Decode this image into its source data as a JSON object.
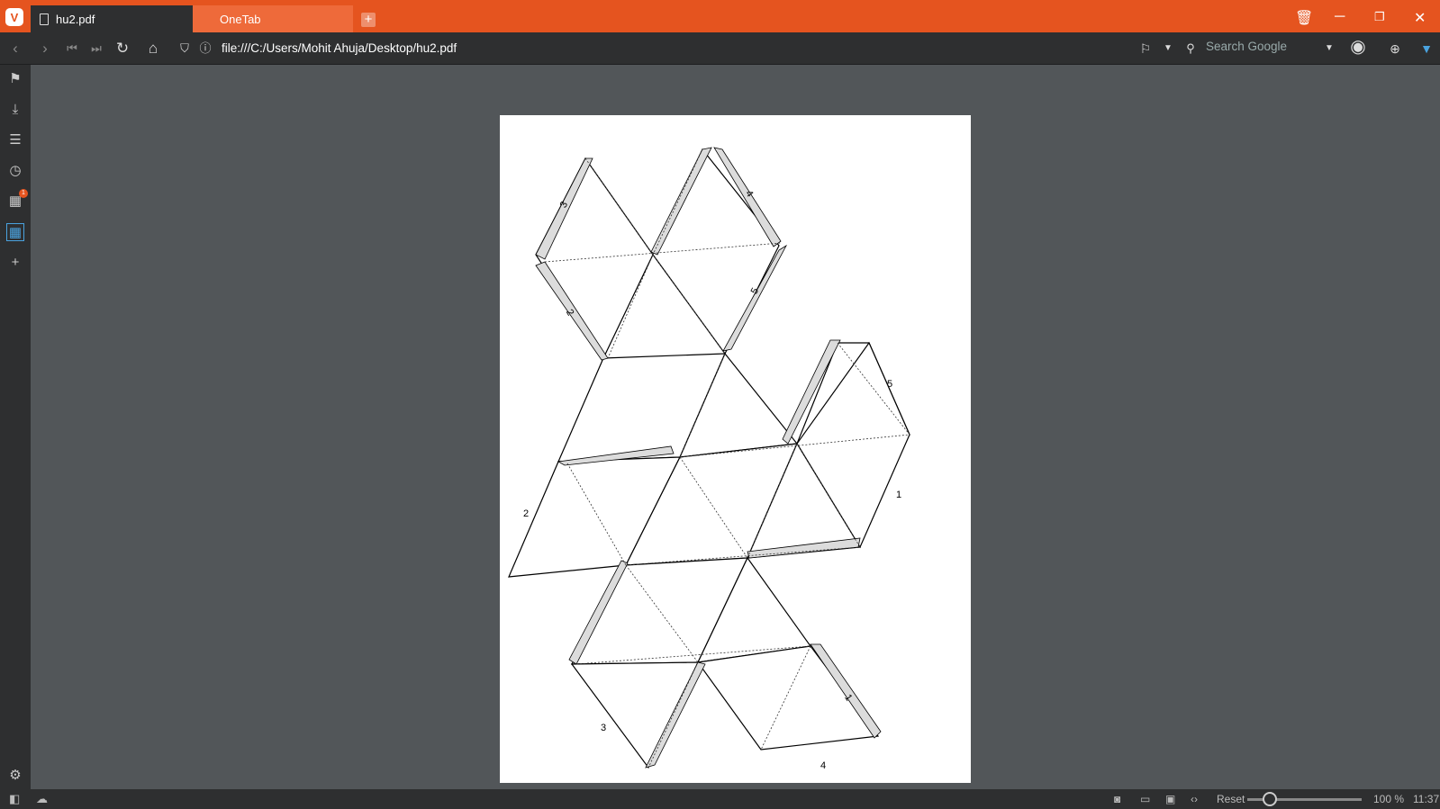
{
  "browser": {
    "tabs": [
      {
        "label": "hu2.pdf"
      },
      {
        "label": "OneTab"
      }
    ],
    "address": "file:///C:/Users/Mohit Ahuja/Desktop/hu2.pdf",
    "search_placeholder": "Search Google",
    "sidebar_badge": "1"
  },
  "status": {
    "reset_label": "Reset",
    "zoom": "100 %",
    "time": "11:37"
  },
  "document": {
    "labels": [
      "3",
      "4",
      "5",
      "2",
      "5",
      "1",
      "2",
      "3",
      "4",
      "1"
    ]
  },
  "colors": {
    "accent": "#e5541f",
    "chrome": "#2e2f30",
    "viewer_bg": "#525659",
    "tab_strip_grey": "#dcdcdc"
  }
}
